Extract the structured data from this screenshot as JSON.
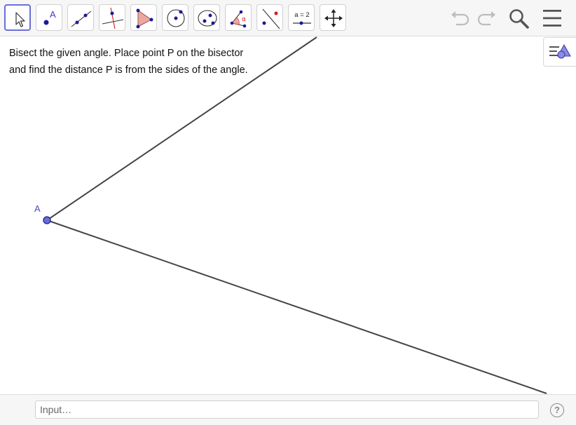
{
  "toolbar": {
    "tools": [
      {
        "icon": "move-arrow-icon",
        "active": true
      },
      {
        "icon": "point-icon",
        "label": "A"
      },
      {
        "icon": "line-icon"
      },
      {
        "icon": "perpendicular-line-icon"
      },
      {
        "icon": "polygon-icon"
      },
      {
        "icon": "circle-center-point-icon"
      },
      {
        "icon": "ellipse-icon"
      },
      {
        "icon": "angle-icon",
        "label": "α"
      },
      {
        "icon": "reflect-about-line-icon"
      },
      {
        "icon": "slider-icon",
        "label": "a = 2"
      },
      {
        "icon": "move-graphics-view-icon"
      }
    ],
    "right_icons": [
      "undo-icon",
      "redo-icon",
      "search-icon",
      "menu-icon"
    ]
  },
  "instructions": {
    "line1": "Bisect the given angle.  Place point P on the bisector",
    "line2": " and find the distance P is from the sides of the angle."
  },
  "construction": {
    "vertex_label": "A"
  },
  "colors": {
    "accent": "#6b6fd6",
    "point_fill": "#6a6ae6",
    "line": "#444444",
    "label": "#4a4ad0"
  },
  "input_bar": {
    "placeholder": "Input…",
    "help_label": "?"
  }
}
